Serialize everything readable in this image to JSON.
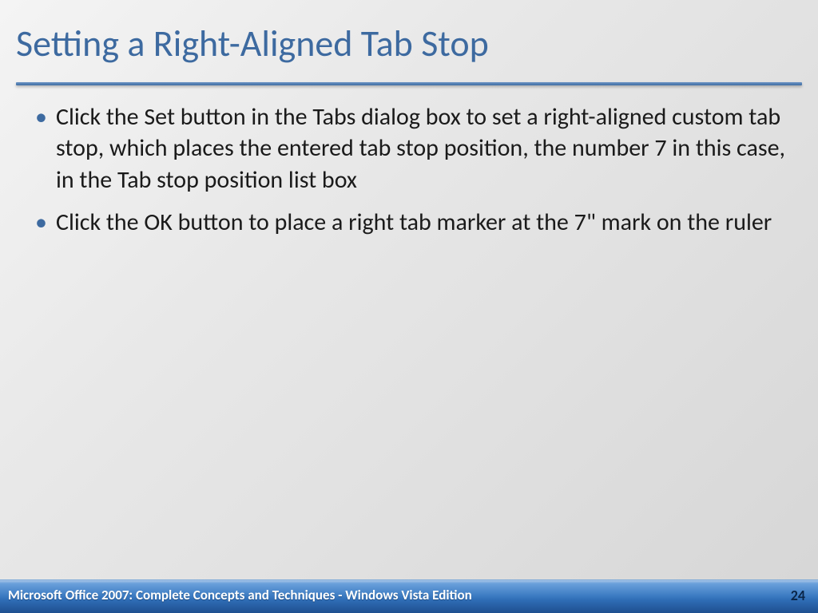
{
  "title": "Setting a Right-Aligned Tab Stop",
  "bullets": [
    "Click the Set button in the Tabs dialog box to set a right-aligned custom tab stop, which places the entered tab stop position, the number 7 in this case, in the Tab stop position list box",
    " Click the OK button to place a right tab marker at the 7\" mark on the ruler"
  ],
  "footer": {
    "left": "Microsoft Office 2007: Complete Concepts and Techniques - Windows Vista Edition",
    "page": "24"
  }
}
